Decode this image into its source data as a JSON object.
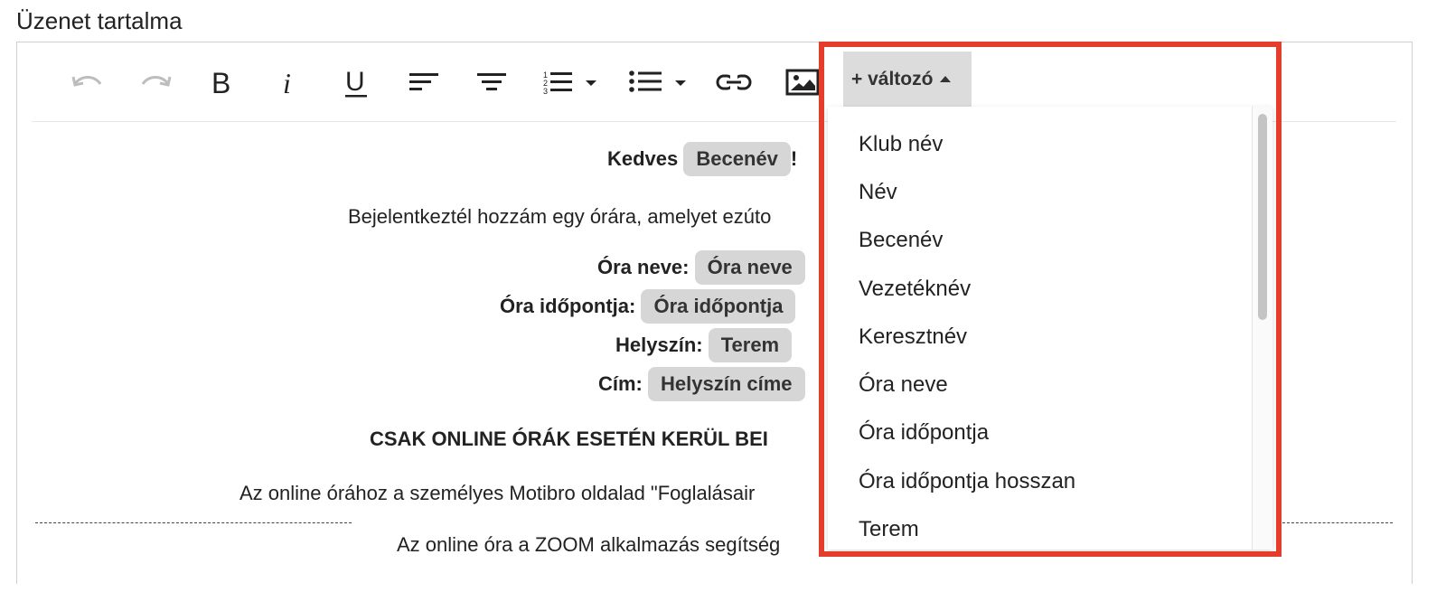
{
  "field_label": "Üzenet tartalma",
  "toolbar": {
    "buttons": [
      {
        "name": "undo-button",
        "icon": "undo-icon",
        "enabled": false
      },
      {
        "name": "redo-button",
        "icon": "redo-icon",
        "enabled": false
      },
      {
        "name": "bold-button",
        "icon": "bold-icon"
      },
      {
        "name": "italic-button",
        "icon": "italic-icon"
      },
      {
        "name": "underline-button",
        "icon": "underline-icon"
      },
      {
        "name": "align-left-button",
        "icon": "align-left-icon"
      },
      {
        "name": "align-center-button",
        "icon": "align-center-icon"
      },
      {
        "name": "numbered-list-button",
        "icon": "numbered-list-icon"
      },
      {
        "name": "bullet-list-button",
        "icon": "bullet-list-icon"
      },
      {
        "name": "link-button",
        "icon": "link-icon"
      },
      {
        "name": "image-button",
        "icon": "image-icon"
      }
    ],
    "variable_button_label": "+ változó"
  },
  "content": {
    "greeting_prefix": "Kedves",
    "greeting_chip": "Becenév",
    "greeting_suffix": "!",
    "intro_text": "Bejelentkeztél hozzám egy órára, amelyet ezúto",
    "fields": [
      {
        "label": "Óra neve:",
        "chip": "Óra neve"
      },
      {
        "label": "Óra időpontja:",
        "chip": "Óra időpontja"
      },
      {
        "label": "Helyszín:",
        "chip": "Terem"
      },
      {
        "label": "Cím:",
        "chip": "Helyszín címe"
      }
    ],
    "online_heading": "CSAK ONLINE ÓRÁK ESETÉN KERÜL BEI",
    "online_text_1": "Az online órához a személyes Motibro oldalad \"Foglalásair",
    "online_text_2": "Az online óra a ZOOM alkalmazás segítség"
  },
  "dropdown": {
    "items": [
      "Klub név",
      "Név",
      "Becenév",
      "Vezetéknév",
      "Keresztnév",
      "Óra neve",
      "Óra időpontja",
      "Óra időpontja hosszan",
      "Terem"
    ]
  },
  "colors": {
    "highlight_border": "#e43d2b",
    "chip_bg": "#d6d6d6",
    "variable_button_bg": "#dcdcdc"
  }
}
